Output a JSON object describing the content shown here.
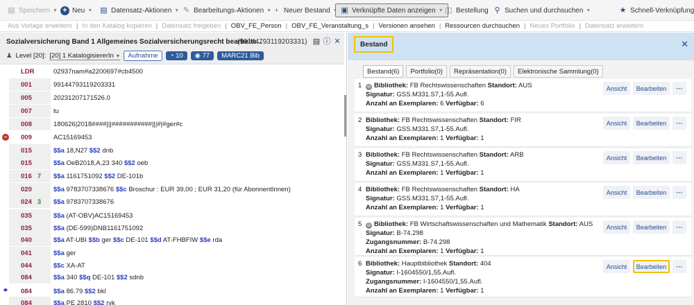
{
  "toolbar": {
    "speichern": "Speichern",
    "neu": "Neu",
    "datensatz_aktionen": "Datensatz-Aktionen",
    "bearbeitungs_aktionen": "Bearbeitungs-Aktionen",
    "neuer_bestand": "Neuer Bestand",
    "verknuepfte": "Verknüpfte Daten anzeigen",
    "bestellung": "Bestellung",
    "suchen": "Suchen und durchsuchen",
    "schnell": "Schnell-Verknüpfungen"
  },
  "linkbar": [
    {
      "label": "Aus Vorlage erweitern",
      "enabled": false
    },
    {
      "label": "In den Katalog kopieren",
      "enabled": false
    },
    {
      "label": "Datensatz freigeben",
      "enabled": false
    },
    {
      "label": "OBV_FE_Person",
      "enabled": true
    },
    {
      "label": "OBV_FE_Veranstaltung_s",
      "enabled": true
    },
    {
      "label": "Versionen ansehen",
      "enabled": true
    },
    {
      "label": "Ressourcen durchsuchen",
      "enabled": true
    },
    {
      "label": "Neues Portfolio",
      "enabled": false
    },
    {
      "label": "Datensatz erweitern",
      "enabled": false
    }
  ],
  "record": {
    "title": "Sozialversicherung Band 1 Allgemeines Sozialversicherungsrecht bearbeite...",
    "id": "(99144793119203331)",
    "level_label": "Level [20]:",
    "level_value": "[20] 1 KatalogisiererIn",
    "aufnahme": "Aufnahme",
    "count1": "10",
    "count2": "77",
    "marc_label": "MARC21 Bib"
  },
  "marc_fields": [
    {
      "tag": "LDR",
      "ind": "",
      "ind_green": false,
      "text": "02937nam#a2200697#cb4500",
      "shade": false,
      "mark": ""
    },
    {
      "tag": "001",
      "ind": "",
      "ind_green": false,
      "text": "99144793119203331",
      "shade": true,
      "mark": ""
    },
    {
      "tag": "005",
      "ind": "",
      "ind_green": false,
      "text": "20231207171526.0",
      "shade": true,
      "mark": ""
    },
    {
      "tag": "007",
      "ind": "",
      "ind_green": false,
      "text": "tu",
      "shade": true,
      "mark": ""
    },
    {
      "tag": "008",
      "ind": "",
      "ind_green": false,
      "text": "180626|2018####|||###########|||#|#ger#c",
      "shade": true,
      "mark": ""
    },
    {
      "tag": "009",
      "ind": "",
      "ind_green": false,
      "text": "AC15169453",
      "shade": false,
      "mark": "minus"
    },
    {
      "tag": "015",
      "ind": "",
      "ind_green": false,
      "text": "$$a 18,N27 $$2 dnb",
      "shade": true,
      "mark": ""
    },
    {
      "tag": "015",
      "ind": "",
      "ind_green": false,
      "text": "$$a OeB2018,A,23 340 $$2 oeb",
      "shade": true,
      "mark": ""
    },
    {
      "tag": "016",
      "ind": "7",
      "ind_green": true,
      "text": "$$a 1161751092 $$2 DE-101b",
      "shade": true,
      "mark": ""
    },
    {
      "tag": "020",
      "ind": "",
      "ind_green": false,
      "text": "$$a 9783707338676 $$c Broschur : EUR 39,00 ; EUR 31,20 (für AbonnentInnen)",
      "shade": true,
      "mark": ""
    },
    {
      "tag": "024",
      "ind": "3",
      "ind_green": true,
      "text": "$$a 9783707338676",
      "shade": true,
      "mark": ""
    },
    {
      "tag": "035",
      "ind": "",
      "ind_green": false,
      "text": "$$a (AT-OBV)AC15169453",
      "shade": true,
      "mark": ""
    },
    {
      "tag": "035",
      "ind": "",
      "ind_green": false,
      "text": "$$a (DE-599)DNB1161751092",
      "shade": true,
      "mark": ""
    },
    {
      "tag": "040",
      "ind": "",
      "ind_green": false,
      "text": "$$a AT-UBI $$b ger $$c DE-101 $$d AT-FHBFIW $$e rda",
      "shade": true,
      "mark": ""
    },
    {
      "tag": "041",
      "ind": "",
      "ind_green": false,
      "text": "$$a ger",
      "shade": true,
      "mark": ""
    },
    {
      "tag": "044",
      "ind": "",
      "ind_green": false,
      "text": "$$c XA-AT",
      "shade": true,
      "mark": ""
    },
    {
      "tag": "084",
      "ind": "",
      "ind_green": false,
      "text": "$$a 340 $$q DE-101 $$2 sdnb",
      "shade": true,
      "mark": ""
    },
    {
      "tag": "084",
      "ind": "",
      "ind_green": false,
      "text": "$$a 86.79 $$2 bkl",
      "shade": false,
      "mark": "link"
    },
    {
      "tag": "084",
      "ind": "",
      "ind_green": false,
      "text": "$$a PE 2810 $$2 rvk",
      "shade": true,
      "mark": ""
    }
  ],
  "bestand": {
    "title": "Bestand",
    "tabs": [
      "Bestand(6)",
      "Portfolio(0)",
      "Repräsentation(0)",
      "Elektronische Sammlung(0)"
    ],
    "labels": {
      "bibliothek": "Bibliothek:",
      "standort": "Standort:",
      "signatur": "Signatur:",
      "zugangsnummer": "Zugangsnummer:",
      "anzahl": "Anzahl an Exemplaren:",
      "verfuegbar": "Verfügbar:"
    },
    "buttons": {
      "ansicht": "Ansicht",
      "bearbeiten": "Bearbeiten",
      "more": "···"
    },
    "items": [
      {
        "num": "1",
        "removed": true,
        "bibliothek": "FB Rechtswissenschaften",
        "standort": "AUS",
        "signatur": "GSS.M331.S7,1-55.Aufl.",
        "zugangsnummer": "",
        "anzahl": "6",
        "verfuegbar": "6",
        "highlight": false
      },
      {
        "num": "2",
        "removed": false,
        "bibliothek": "FB Rechtswissenschaften",
        "standort": "FIR",
        "signatur": "GSS.M331.S7,1-55.Aufl.",
        "zugangsnummer": "",
        "anzahl": "1",
        "verfuegbar": "1",
        "highlight": false
      },
      {
        "num": "3",
        "removed": false,
        "bibliothek": "FB Rechtswissenschaften",
        "standort": "ARB",
        "signatur": "GSS.M331.S7,1-55.Aufl.",
        "zugangsnummer": "",
        "anzahl": "1",
        "verfuegbar": "1",
        "highlight": false
      },
      {
        "num": "4",
        "removed": false,
        "bibliothek": "FB Rechtswissenschaften",
        "standort": "HA",
        "signatur": "GSS.M331.S7,1-55.Aufl.",
        "zugangsnummer": "",
        "anzahl": "1",
        "verfuegbar": "1",
        "highlight": false
      },
      {
        "num": "5",
        "removed": true,
        "bibliothek": "FB Wirtschaftswissenschaften und Mathematik",
        "standort": "AUS",
        "signatur": "B-74.298",
        "zugangsnummer": "B-74.298",
        "anzahl": "1",
        "verfuegbar": "1",
        "highlight": false
      },
      {
        "num": "6",
        "removed": false,
        "bibliothek": "Hauptbibliothek",
        "standort": "404",
        "signatur": "I-1604550/1,55.Aufl.",
        "zugangsnummer": "I-1604550/1,55.Aufl.",
        "anzahl": "1",
        "verfuegbar": "1",
        "highlight": true
      }
    ]
  }
}
